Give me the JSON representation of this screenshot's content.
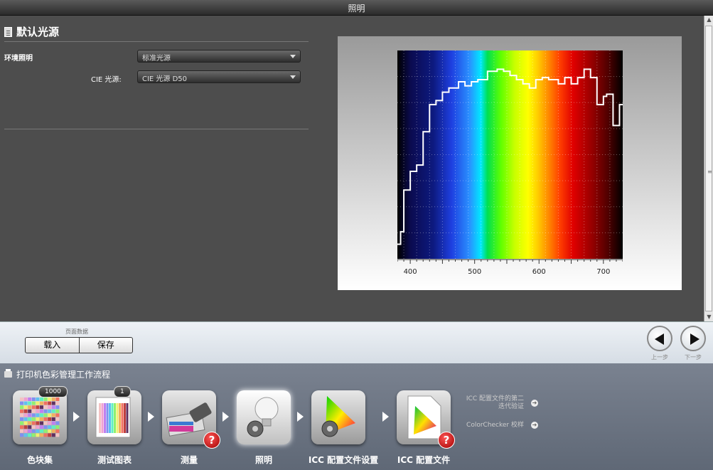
{
  "window": {
    "title": "照明"
  },
  "panel": {
    "heading": "默认光源",
    "ambient_label": "环境照明",
    "ambient_value": "标准光源",
    "cie_label": "CIE 光源:",
    "cie_value": "CIE 光源 D50"
  },
  "chart_data": {
    "type": "line",
    "title": "",
    "xlabel": "",
    "ylabel": "",
    "xlim": [
      380,
      730
    ],
    "ylim": [
      0,
      1.0
    ],
    "xticks": [
      "400",
      "500",
      "600",
      "700"
    ],
    "grid": true,
    "series": [
      {
        "x": [
          380,
          385,
          390,
          395,
          400,
          405,
          410,
          415,
          420,
          425,
          430,
          435,
          440,
          445,
          450,
          455,
          460,
          465,
          470,
          475,
          480,
          485,
          490,
          495,
          500,
          505,
          510,
          515,
          520,
          525,
          530,
          535,
          540,
          545,
          550,
          555,
          560,
          565,
          570,
          575,
          580,
          585,
          590,
          595,
          600,
          605,
          610,
          615,
          620,
          625,
          630,
          635,
          640,
          645,
          650,
          655,
          660,
          665,
          670,
          675,
          680,
          685,
          690,
          695,
          700,
          705,
          710,
          715,
          720,
          725,
          730
        ],
        "y": [
          0.07,
          0.13,
          0.33,
          0.33,
          0.42,
          0.42,
          0.45,
          0.45,
          0.61,
          0.61,
          0.74,
          0.74,
          0.76,
          0.76,
          0.8,
          0.8,
          0.82,
          0.82,
          0.82,
          0.85,
          0.85,
          0.83,
          0.83,
          0.85,
          0.85,
          0.86,
          0.86,
          0.86,
          0.9,
          0.9,
          0.9,
          0.91,
          0.91,
          0.9,
          0.9,
          0.88,
          0.88,
          0.86,
          0.86,
          0.84,
          0.84,
          0.82,
          0.82,
          0.86,
          0.86,
          0.87,
          0.87,
          0.86,
          0.86,
          0.86,
          0.84,
          0.84,
          0.87,
          0.87,
          0.84,
          0.84,
          0.87,
          0.87,
          0.91,
          0.91,
          0.87,
          0.87,
          0.74,
          0.74,
          0.78,
          0.79,
          0.79,
          0.64,
          0.64,
          0.74,
          0.74
        ]
      }
    ]
  },
  "toolbar": {
    "page_data_label": "页面数据",
    "load_label": "载入",
    "save_label": "保存",
    "prev_label": "上一步",
    "next_label": "下一步"
  },
  "workflow": {
    "title": "打印机色彩管理工作流程",
    "steps": [
      {
        "label": "色块集",
        "badge": "1000"
      },
      {
        "label": "测试图表",
        "badge": "1"
      },
      {
        "label": "测量"
      },
      {
        "label": "照明"
      },
      {
        "label": "ICC 配置文件设置"
      },
      {
        "label": "ICC 配置文件"
      }
    ],
    "side_links": [
      {
        "text": "ICC 配置文件的第二迭代验证"
      },
      {
        "text": "ColorChecker 校样"
      }
    ]
  }
}
